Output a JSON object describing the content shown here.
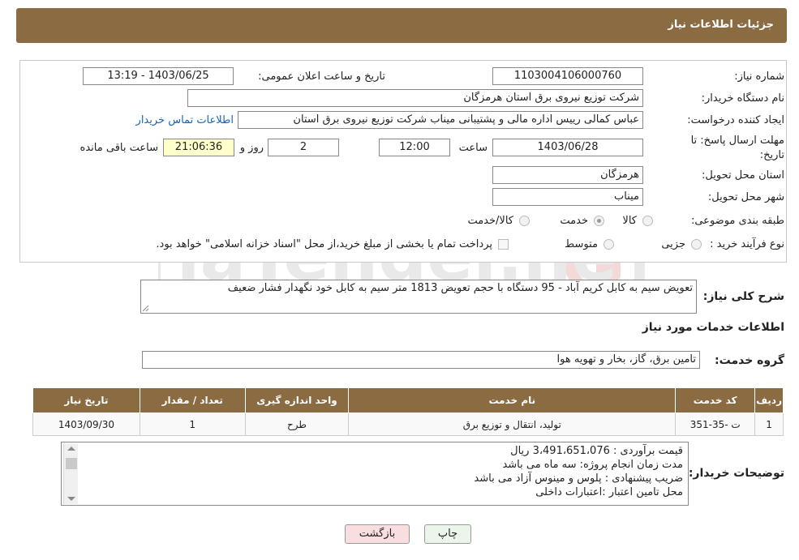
{
  "header": {
    "title": "جزئیات اطلاعات نیاز"
  },
  "form": {
    "need_number_label": "شماره نیاز:",
    "need_number": "1103004106000760",
    "announce_label": "تاریخ و ساعت اعلان عمومی:",
    "announce_value": "1403/06/25 - 13:19",
    "buyer_label": "نام دستگاه خریدار:",
    "buyer_value": "شرکت توزیع نیروی برق استان هرمزگان",
    "creator_label": "ایجاد کننده درخواست:",
    "creator_value": "عباس کمالی رییس اداره مالی و پشتیبانی میناب شرکت توزیع نیروی برق استان",
    "contact_link": "اطلاعات تماس خریدار",
    "deadline_label": "مهلت ارسال پاسخ: تا تاریخ:",
    "deadline_date": "1403/06/28",
    "time_label": "ساعت",
    "deadline_time": "12:00",
    "days_value": "2",
    "days_label": "روز و",
    "remaining_value": "21:06:36",
    "remaining_label": "ساعت باقی مانده",
    "province_label": "استان محل تحویل:",
    "province_value": "هرمزگان",
    "city_label": "شهر محل تحویل:",
    "city_value": "میناب",
    "category_label": "طبقه بندی موضوعی:",
    "category_options": [
      "کالا",
      "خدمت",
      "کالا/خدمت"
    ],
    "category_selected": "خدمت",
    "process_label": "نوع فرآیند خرید :",
    "process_options": [
      "جزیی",
      "متوسط"
    ],
    "payment_note": "پرداخت تمام یا بخشی از مبلغ خرید،از محل \"اسناد خزانه اسلامی\" خواهد بود."
  },
  "summary": {
    "label": "شرح کلی نیاز:",
    "text": "تعویض  سیم به کابل کریم آباد - 95 دستگاه  با حجم تعویض 1813 متر سیم به کابل خود نگهدار فشار ضعیف"
  },
  "services": {
    "section_title": "اطلاعات خدمات مورد نیاز",
    "group_label": "گروه خدمت:",
    "group_value": "تامین برق، گاز، بخار و تهویه هوا",
    "columns": [
      "ردیف",
      "کد خدمت",
      "نام خدمت",
      "واحد اندازه گیری",
      "تعداد / مقدار",
      "تاریخ نیاز"
    ],
    "rows": [
      [
        "1",
        "ت -35-351",
        "تولید، انتقال و توزیع برق",
        "طرح",
        "1",
        "1403/09/30"
      ]
    ]
  },
  "buyer_notes": {
    "label": "توضیحات خریدار:",
    "lines": [
      "قیمت برآوردی : 3،491،651،076 ریال",
      "مدت زمان انجام پروژه: سه ماه می باشد",
      "ضریب پیشنهادی : پلوس و مینوس آزاد می باشد",
      "محل تامین اعتبار :اعتبارات داخلی"
    ]
  },
  "buttons": {
    "print": "چاپ",
    "back": "بازگشت"
  },
  "watermark": {
    "text": "AriaTender.neT"
  },
  "colors": {
    "header": "#8b6c42",
    "back_button": "#f8dede",
    "print_button": "#eaf6e9"
  }
}
